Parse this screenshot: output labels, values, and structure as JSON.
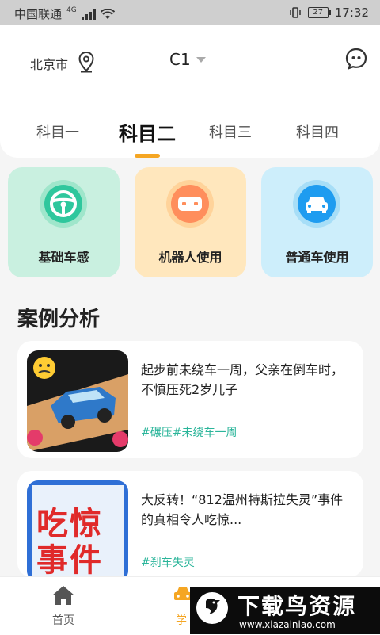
{
  "status_bar": {
    "carrier": "中国联通",
    "network": "4G",
    "battery": "27",
    "time": "17:32"
  },
  "header": {
    "city": "北京市",
    "license_type": "C1"
  },
  "tabs": [
    {
      "label": "科目一"
    },
    {
      "label": "科目二"
    },
    {
      "label": "科目三"
    },
    {
      "label": "科目四"
    }
  ],
  "categories": [
    {
      "label": "基础车感",
      "bg": "#c9f0e0",
      "icon": "steering-wheel-icon"
    },
    {
      "label": "机器人使用",
      "bg": "#ffe7bd",
      "icon": "robot-icon"
    },
    {
      "label": "普通车使用",
      "bg": "#cdeefb",
      "icon": "car-icon"
    }
  ],
  "section": {
    "title": "案例分析"
  },
  "articles": [
    {
      "title": "起步前未绕车一周，父亲在倒车时，不慎压死2岁儿子",
      "tag": "#碾压#未绕车一周"
    },
    {
      "title": "大反转！“812温州特斯拉失灵”事件的真相令人吃惊...",
      "tag": "#刹车失灵",
      "thumb_text_1": "吃惊",
      "thumb_text_2": "事件"
    }
  ],
  "bottom_nav": {
    "home": "首页",
    "study": "学"
  },
  "watermark": {
    "title": "下载鸟资源",
    "url": "www.xiazainiao.com"
  },
  "colors": {
    "accent": "#f5a623",
    "tag": "#2bb59a"
  }
}
